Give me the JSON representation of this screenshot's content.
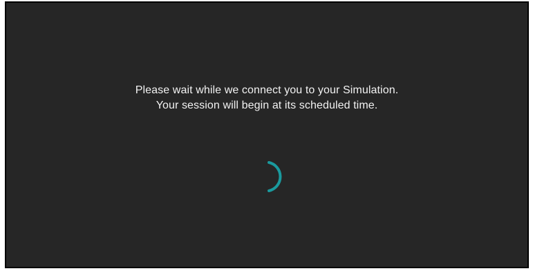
{
  "loading_screen": {
    "message_line_1": "Please wait while we connect you to your Simulation.",
    "message_line_2": "Your session will begin at its scheduled time.",
    "spinner_icon": "loading-spinner-icon"
  },
  "colors": {
    "background": "#262626",
    "border": "#000000",
    "text": "#f2f2f2",
    "spinner": "#1a9a9e"
  }
}
